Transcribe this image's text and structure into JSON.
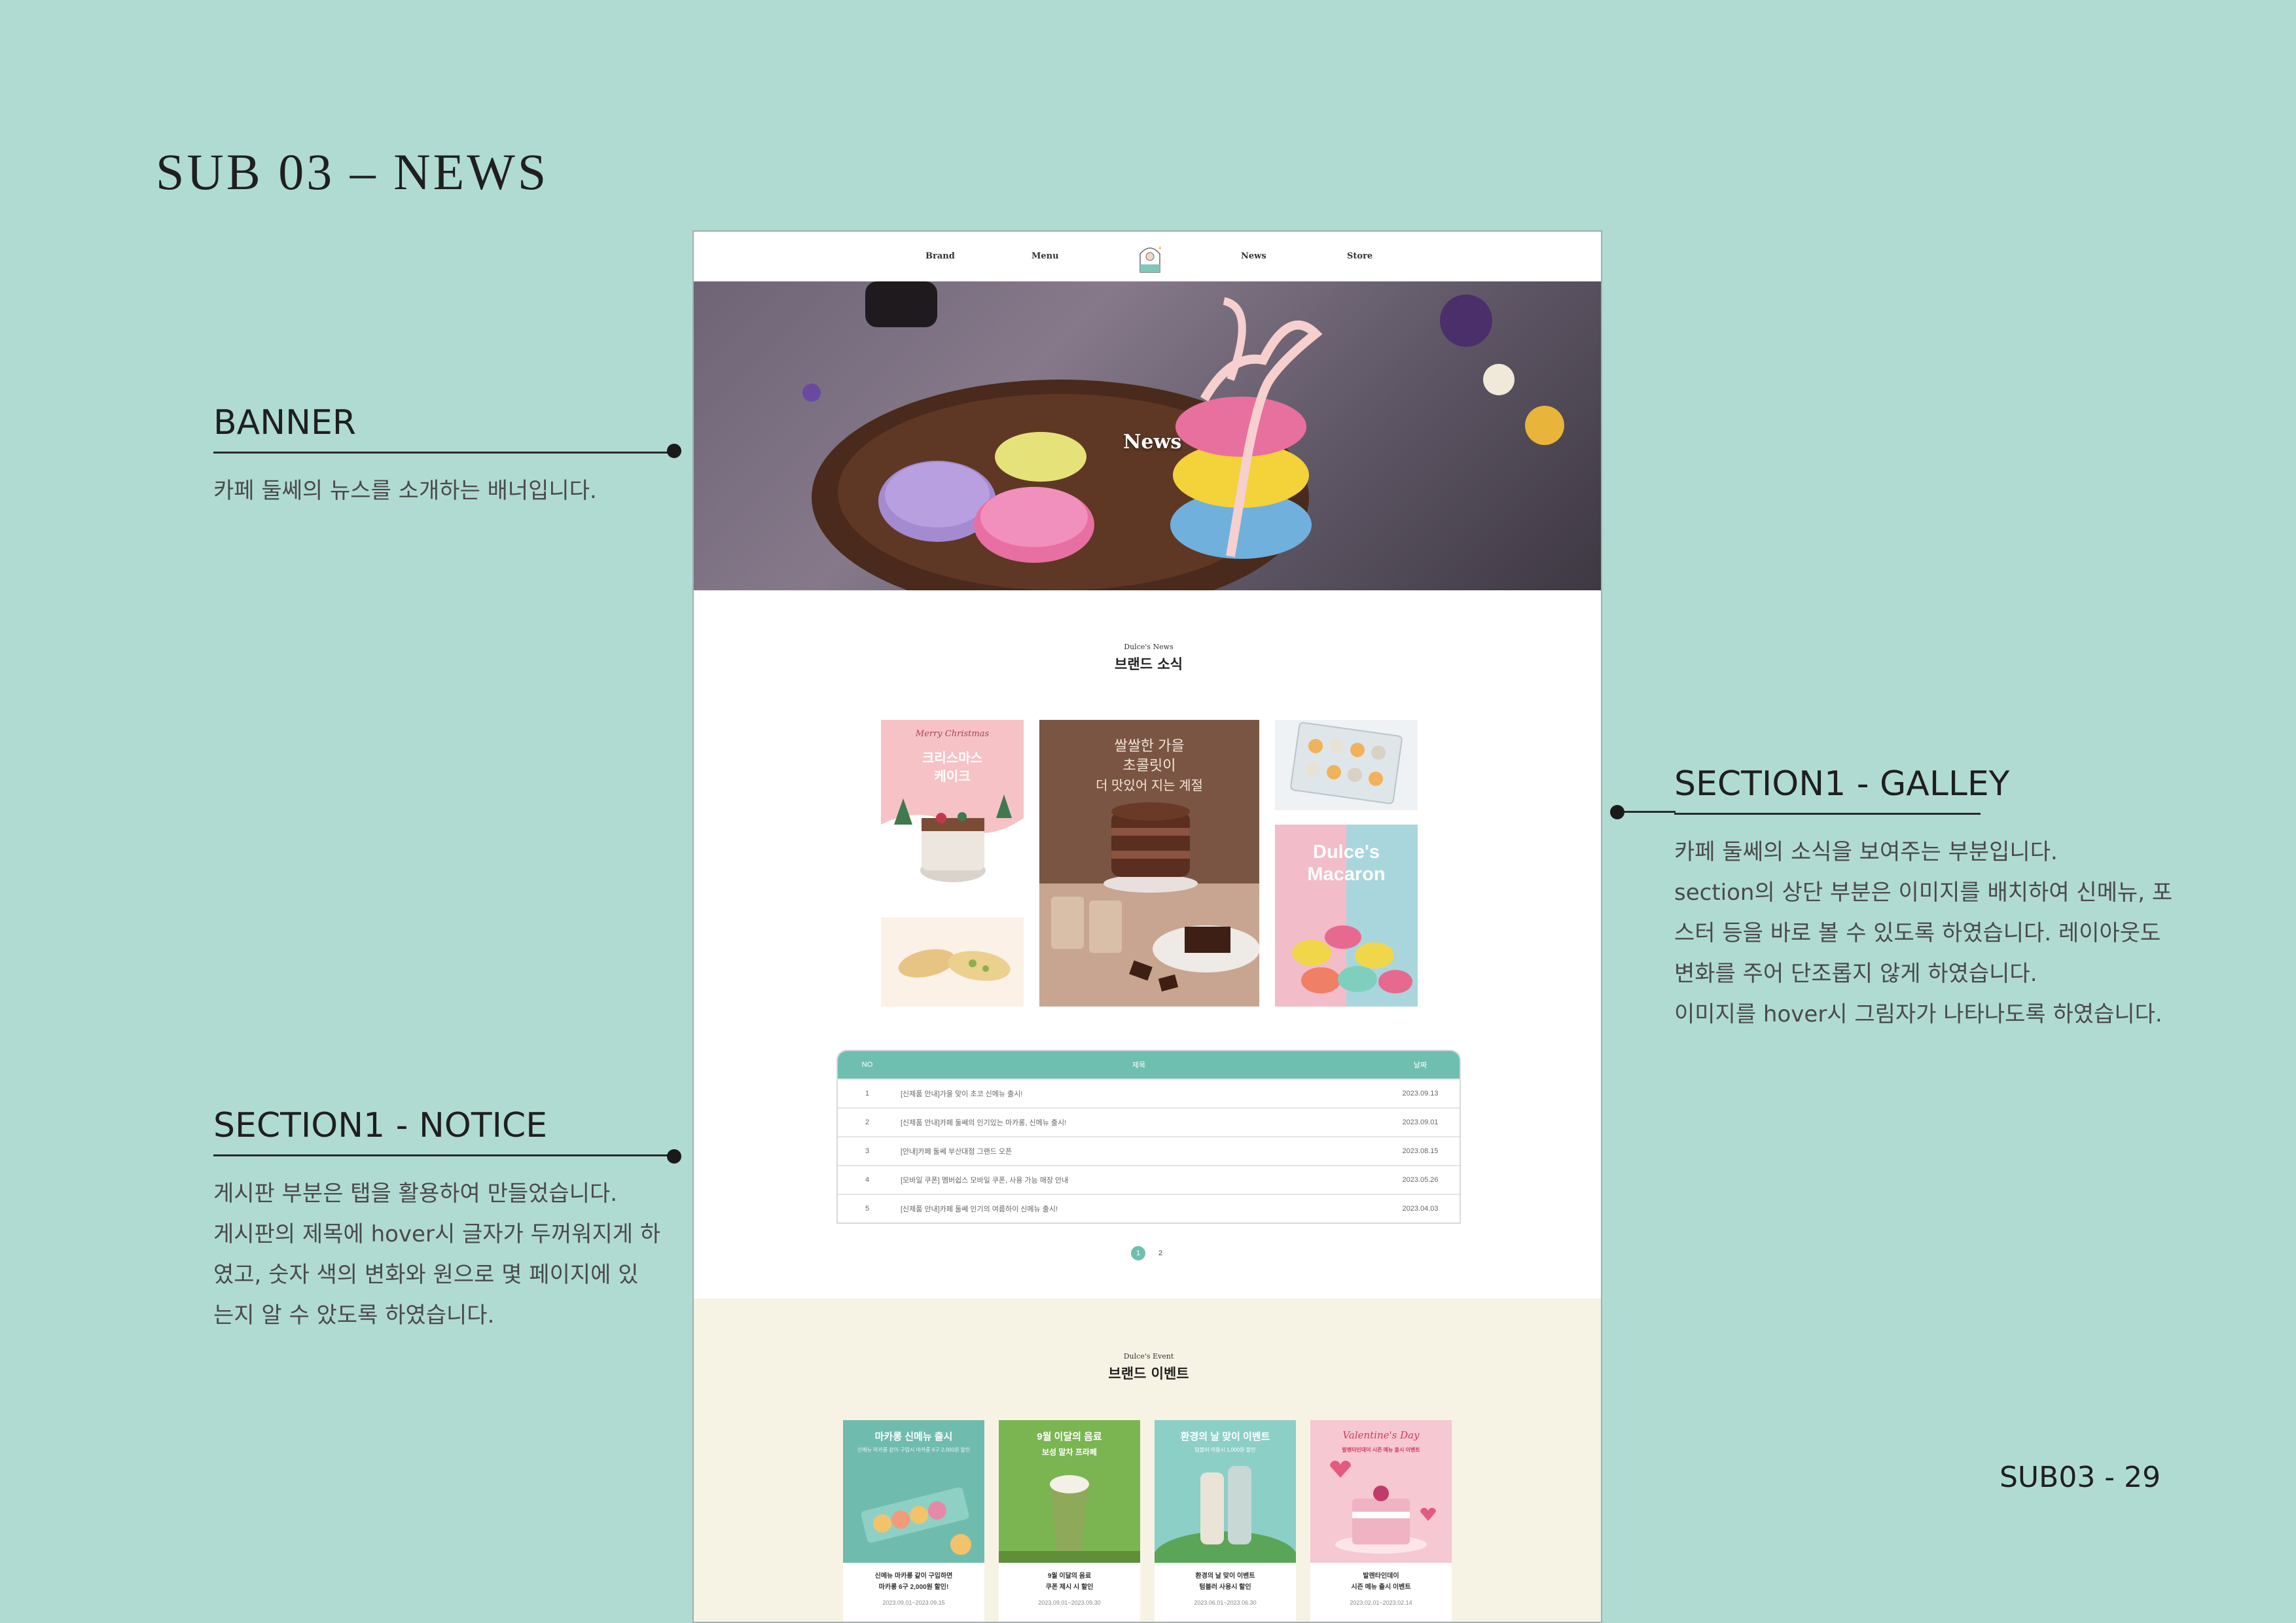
{
  "presentation": {
    "title": "SUB 03 – NEWS",
    "page_number": "SUB03 - 29",
    "annotations": {
      "banner": {
        "heading": "BANNER",
        "lines": [
          "카페 둘쎄의 뉴스를 소개하는 배너입니다."
        ]
      },
      "gallery": {
        "heading": "SECTION1 - GALLEY",
        "lines": [
          "카페 둘쎄의 소식을 보여주는 부분입니다.",
          "section의 상단 부분은 이미지를 배치하여 신메뉴, 포",
          "스터 등을 바로 볼 수 있도록 하였습니다. 레이아웃도",
          "변화를 주어 단조롭지 않게 하였습니다.",
          "이미지를 hover시 그림자가 나타나도록 하였습니다."
        ]
      },
      "notice": {
        "heading": "SECTION1 - NOTICE",
        "lines": [
          "게시판 부분은 탭을 활용하여 만들었습니다.",
          "게시판의 제목에 hover시 글자가 두꺼워지게 하",
          "였고,  숫자 색의 변화와 원으로 몇 페이지에 있",
          "는지 알 수 았도록 하였습니다."
        ]
      }
    }
  },
  "site": {
    "nav": [
      "Brand",
      "Menu",
      "News",
      "Store"
    ],
    "banner_title": "News",
    "news_section": {
      "sub": "Dulce's News",
      "title": "브랜드 소식"
    },
    "gallery": {
      "christmas_script": "Merry Christmas",
      "christmas_title_1": "크리스마스",
      "christmas_title_2": "케이크",
      "choco_line_1": "쌀쌀한 가을",
      "choco_line_2": "초콜릿이",
      "choco_line_3": "더 맛있어 지는 계절",
      "macaron_line_1": "Dulce's",
      "macaron_line_2": "Macaron"
    },
    "notice": {
      "headers": {
        "no": "NO",
        "title": "제목",
        "date": "날짜"
      },
      "rows": [
        {
          "no": "1",
          "title": "[신제품 안내]가을 맞이 초코 신메뉴 출시!",
          "date": "2023.09.13"
        },
        {
          "no": "2",
          "title": "[신제품 안내]카페 둘쎄의 인기있는 마카롱, 신메뉴 출시!",
          "date": "2023.09.01"
        },
        {
          "no": "3",
          "title": "[안내]카페 둘쎄 부산대점 그랜드 오픈",
          "date": "2023.08.15"
        },
        {
          "no": "4",
          "title": "[모바일 쿠폰] 멤버쉽스 모바일 쿠폰, 사용 가능 매장 안내",
          "date": "2023.05.26"
        },
        {
          "no": "5",
          "title": "[신제품 안내]카페 둘쎄 인기의 여름하이 신메뉴 출시!",
          "date": "2023.04.03"
        }
      ],
      "pages": [
        "1",
        "2"
      ]
    },
    "event_section": {
      "sub": "Dulce's Event",
      "title": "브랜드 이벤트"
    },
    "events": [
      {
        "img_title": "마카롱 신메뉴 출시",
        "img_sub": "신메뉴 마카롱 같이 구입시 마카롱 6구 2,000원 할인",
        "caption_1": "신메뉴 마카롱 같이 구입하면",
        "caption_2": "마카롱 6구 2,000원 할인!",
        "date": "2023.09.01~2023.09.15",
        "color": "#6fbcae"
      },
      {
        "img_title": "9월 이달의 음료",
        "img_sub": "보성 말차 프라페",
        "caption_1": "9월 이달의 음료",
        "caption_2": "쿠폰 제시 시 할인",
        "date": "2023.09.01~2023.09.30",
        "color": "#6fa84a"
      },
      {
        "img_title": "환경의 날 맞이 이벤트",
        "img_sub": "텀블러 이용시 1,000원 할인",
        "caption_1": "환경의 날 맞이 이벤트",
        "caption_2": "텀블러 사용시 할인",
        "date": "2023.06.01~2023.06.30",
        "color": "#8ccfc7"
      },
      {
        "img_title": "Valentine's Day",
        "img_sub": "발렌타인데이 시즌 메뉴 출시 이벤트",
        "caption_1": "발렌타인데이",
        "caption_2": "시즌 메뉴 출시 이벤트",
        "date": "2023.02.01~2023.02.14",
        "color": "#f5c8d2"
      }
    ]
  }
}
